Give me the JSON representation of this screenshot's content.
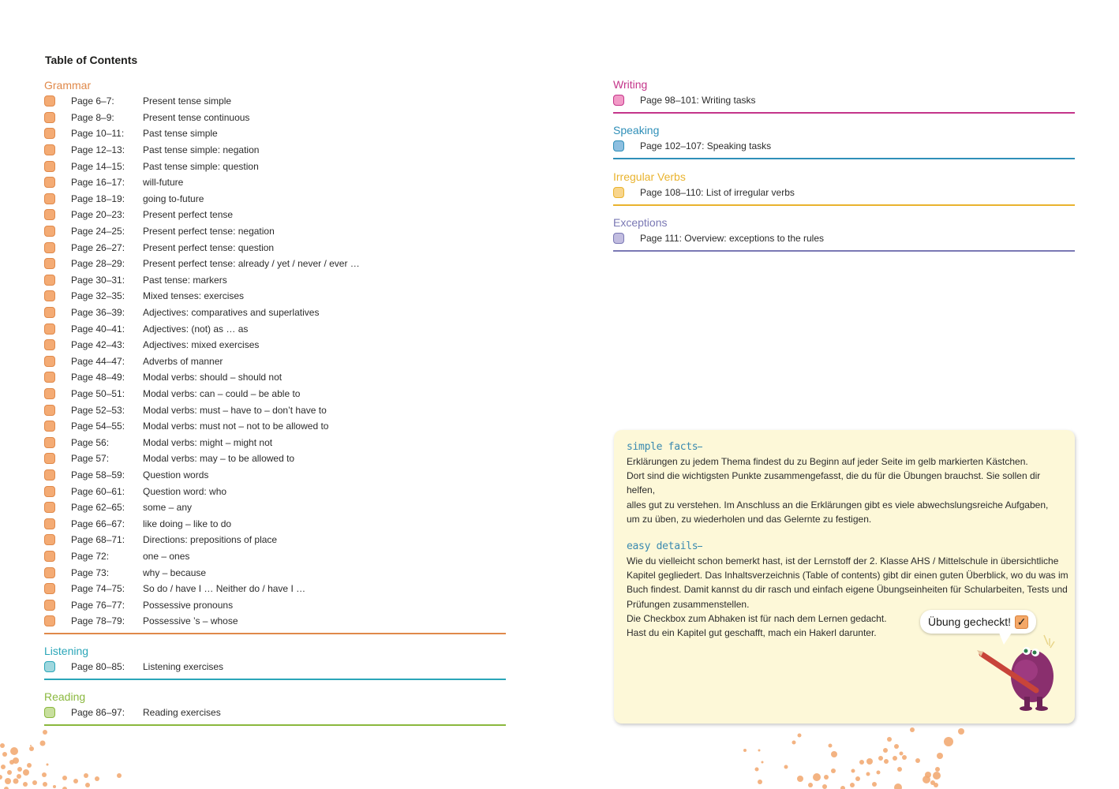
{
  "page": {
    "title": "Table of Contents"
  },
  "colors": {
    "grammar": "#e0894a",
    "grammar_fill": "#f4ab74",
    "listening": "#2aa6b8",
    "listening_fill": "#9fd7de",
    "reading": "#8ab83e",
    "reading_fill": "#c8df9e",
    "writing": "#c4358a",
    "writing_fill": "#f29ac7",
    "speaking": "#2f8fb8",
    "speaking_fill": "#8dbfe0",
    "irregular": "#e9b32e",
    "irregular_fill": "#f8d58c",
    "exceptions": "#7a78b4",
    "exceptions_fill": "#c2bde0",
    "infobox_bg": "#fdf8d8",
    "dots": "#f2ab74"
  },
  "grammar": {
    "heading": "Grammar",
    "items": [
      {
        "pages": "Page 6–7:",
        "topic": "Present tense simple"
      },
      {
        "pages": "Page 8–9:",
        "topic": "Present tense continuous"
      },
      {
        "pages": "Page 10–11:",
        "topic": "Past tense simple"
      },
      {
        "pages": "Page 12–13:",
        "topic": "Past tense simple: negation"
      },
      {
        "pages": "Page 14–15:",
        "topic": "Past tense simple: question"
      },
      {
        "pages": "Page 16–17:",
        "topic": "will-future"
      },
      {
        "pages": "Page 18–19:",
        "topic": "going to-future"
      },
      {
        "pages": "Page 20–23:",
        "topic": "Present perfect tense"
      },
      {
        "pages": "Page 24–25:",
        "topic": "Present perfect tense: negation"
      },
      {
        "pages": "Page 26–27:",
        "topic": "Present perfect tense: question"
      },
      {
        "pages": "Page 28–29:",
        "topic": "Present perfect tense: already / yet / never / ever …"
      },
      {
        "pages": "Page 30–31:",
        "topic": "Past tense: markers"
      },
      {
        "pages": "Page 32–35:",
        "topic": "Mixed tenses: exercises"
      },
      {
        "pages": "Page 36–39:",
        "topic": "Adjectives: comparatives and superlatives"
      },
      {
        "pages": "Page 40–41:",
        "topic": "Adjectives: (not) as … as"
      },
      {
        "pages": "Page 42–43:",
        "topic": "Adjectives: mixed exercises"
      },
      {
        "pages": "Page 44–47:",
        "topic": "Adverbs of manner"
      },
      {
        "pages": "Page 48–49:",
        "topic": "Modal verbs: should – should not"
      },
      {
        "pages": "Page 50–51:",
        "topic": "Modal verbs: can – could – be able to"
      },
      {
        "pages": "Page 52–53:",
        "topic": "Modal verbs: must – have to – don’t have to"
      },
      {
        "pages": "Page 54–55:",
        "topic": "Modal verbs: must not – not to be allowed to"
      },
      {
        "pages": "Page 56:",
        "topic": "Modal verbs: might – might not"
      },
      {
        "pages": "Page 57:",
        "topic": "Modal verbs: may – to be allowed to"
      },
      {
        "pages": "Page 58–59:",
        "topic": "Question words"
      },
      {
        "pages": "Page 60–61:",
        "topic": "Question word: who"
      },
      {
        "pages": "Page 62–65:",
        "topic": "some – any"
      },
      {
        "pages": "Page 66–67:",
        "topic": "like doing – like to do"
      },
      {
        "pages": "Page 68–71:",
        "topic": "Directions: prepositions of place"
      },
      {
        "pages": "Page 72:",
        "topic": "one – ones"
      },
      {
        "pages": "Page 73:",
        "topic": "why – because"
      },
      {
        "pages": "Page 74–75:",
        "topic": "So do / have I … Neither do / have I …"
      },
      {
        "pages": "Page 76–77:",
        "topic": "Possessive pronouns"
      },
      {
        "pages": "Page 78–79:",
        "topic": "Possessive ’s – whose"
      }
    ]
  },
  "listening": {
    "heading": "Listening",
    "items": [
      {
        "pages": "Page 80–85:",
        "topic": "Listening exercises"
      }
    ]
  },
  "reading": {
    "heading": "Reading",
    "items": [
      {
        "pages": "Page 86–97:",
        "topic": "Reading exercises"
      }
    ]
  },
  "writing": {
    "heading": "Writing",
    "items": [
      {
        "label": "Page 98–101: Writing tasks"
      }
    ]
  },
  "speaking": {
    "heading": "Speaking",
    "items": [
      {
        "label": "Page 102–107: Speaking tasks"
      }
    ]
  },
  "irregular": {
    "heading": "Irregular Verbs",
    "items": [
      {
        "label": "Page 108–110: List of irregular verbs"
      }
    ]
  },
  "exceptions": {
    "heading": "Exceptions",
    "items": [
      {
        "label": "Page 111: Overview: exceptions to the rules"
      }
    ]
  },
  "infobox": {
    "simple_facts": {
      "heading": "simple facts",
      "lines": [
        "Erklärungen zu jedem Thema findest du zu Beginn auf jeder Seite im gelb markierten Kästchen.",
        "Dort sind die wichtigsten Punkte zusammengefasst, die du für die Übungen brauchst. Sie sollen dir helfen,",
        "alles gut zu verstehen. Im Anschluss an die Erklärungen gibt es viele abwechslungsreiche Aufgaben,",
        "um zu üben, zu wiederholen und das Gelernte zu festigen."
      ]
    },
    "easy_details": {
      "heading": "easy details",
      "lines": [
        "Wie du vielleicht schon bemerkt hast, ist der Lernstoff der 2. Klasse AHS / Mittelschule in übersichtliche",
        "Kapitel gegliedert. Das Inhaltsverzeichnis (Table of contents) gibt dir einen guten Überblick, wo du was im",
        "Buch findest. Damit kannst du dir rasch und einfach eigene Übungseinheiten für Schularbeiten, Tests und",
        "Prüfungen zusammenstellen.",
        "Die Checkbox zum Abhaken ist für nach dem Lernen gedacht.",
        "Hast du ein Kapitel gut geschafft, mach ein Hakerl darunter."
      ]
    },
    "bubble": {
      "text": "Übung gecheckt!",
      "check": "✓"
    },
    "mascot": "purple-monster-with-pencil"
  }
}
